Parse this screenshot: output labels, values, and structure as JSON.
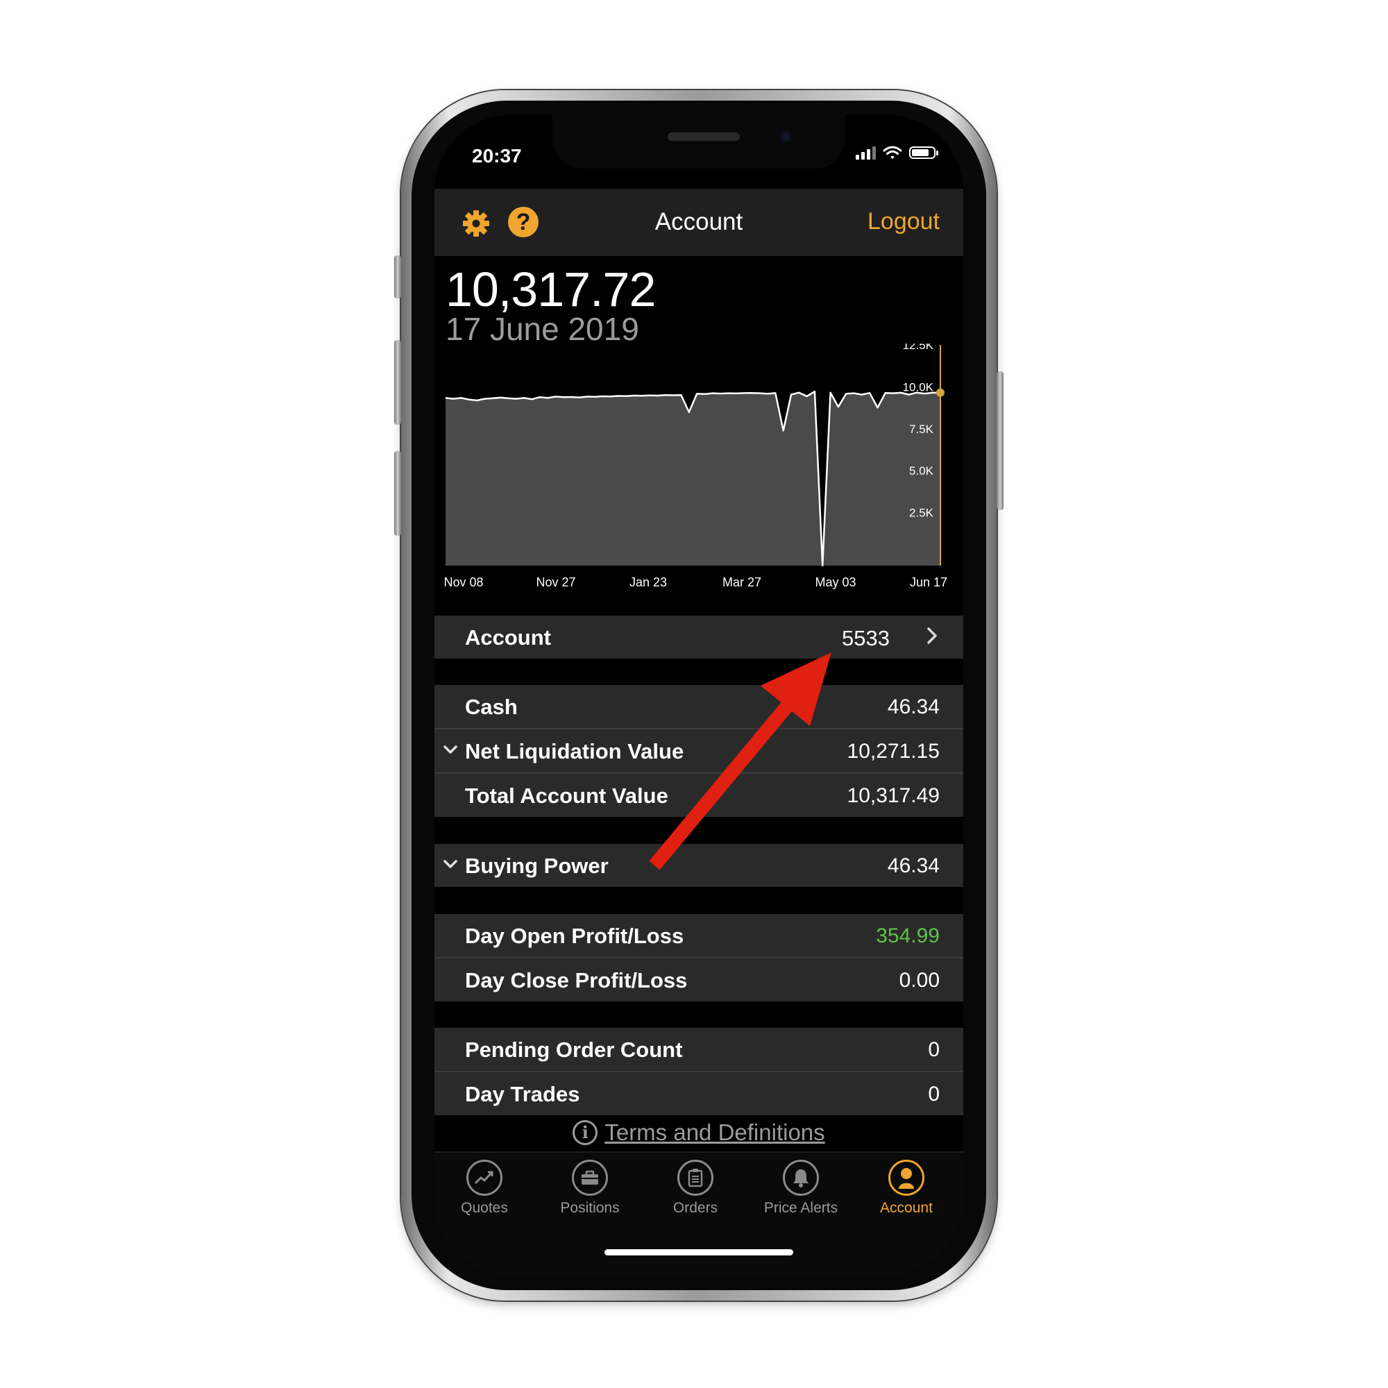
{
  "status_bar": {
    "time": "20:37"
  },
  "nav": {
    "title": "Account",
    "logout_label": "Logout",
    "help_symbol": "?"
  },
  "summary": {
    "value": "10,317.72",
    "date": "17 June 2019"
  },
  "chart_data": {
    "type": "area",
    "title": "",
    "xlabel": "",
    "ylabel": "",
    "x_ticks": [
      "Nov 08",
      "Nov 27",
      "Jan 23",
      "Mar 27",
      "May 03",
      "Jun 17"
    ],
    "y_ticks": [
      "12.5K",
      "10.0K",
      "7.5K",
      "5.0K",
      "2.5K"
    ],
    "ylim": [
      0,
      12500
    ],
    "series": [
      {
        "values": [
          10000,
          9950,
          10000,
          9900,
          9850,
          9950,
          9980,
          10020,
          9980,
          9950,
          10000,
          9920,
          10050,
          10000,
          10080,
          10050,
          10060,
          10030,
          10080,
          10070,
          10100,
          10090,
          10120,
          10110,
          10140,
          10130,
          10150,
          10140,
          10170,
          10160,
          10170,
          9150,
          10250,
          10230,
          10280,
          10260,
          10280,
          10270,
          10290,
          10300,
          10280,
          10250,
          10290,
          8050,
          10200,
          10320,
          10100,
          10380,
          0,
          10320,
          9470,
          10250,
          10280,
          10200,
          10300,
          9420,
          10300,
          10280,
          10310,
          10200,
          10320,
          10260,
          10310,
          10317
        ]
      }
    ],
    "grid": false,
    "highlight_color": "#d9a441",
    "fill_color": "#4a4a4a",
    "line_color": "#ffffff"
  },
  "account_row": {
    "label": "Account",
    "value": "5533"
  },
  "group1": [
    {
      "label": "Cash",
      "value": "46.34"
    },
    {
      "label": "Net Liquidation Value",
      "value": "10,271.15"
    },
    {
      "label": "Total Account Value",
      "value": "10,317.49"
    }
  ],
  "group2": [
    {
      "label": "Buying Power",
      "value": "46.34"
    }
  ],
  "group3": [
    {
      "label": "Day Open Profit/Loss",
      "value": "354.99",
      "value_color": "#5ec24a"
    },
    {
      "label": "Day Close Profit/Loss",
      "value": "0.00"
    }
  ],
  "group4": [
    {
      "label": "Pending Order Count",
      "value": "0"
    },
    {
      "label": "Day Trades",
      "value": "0"
    }
  ],
  "terms": {
    "label": "Terms and Definitions"
  },
  "tabs": [
    {
      "label": "Quotes",
      "icon": "chart-trend-icon"
    },
    {
      "label": "Positions",
      "icon": "briefcase-icon"
    },
    {
      "label": "Orders",
      "icon": "clipboard-icon"
    },
    {
      "label": "Price Alerts",
      "icon": "bell-icon"
    },
    {
      "label": "Account",
      "icon": "person-icon",
      "active": true
    }
  ],
  "colors": {
    "accent": "#f0a52e",
    "row_bg": "#2a2a2a",
    "positive": "#5ec24a",
    "annotation_arrow": "#e02010"
  }
}
